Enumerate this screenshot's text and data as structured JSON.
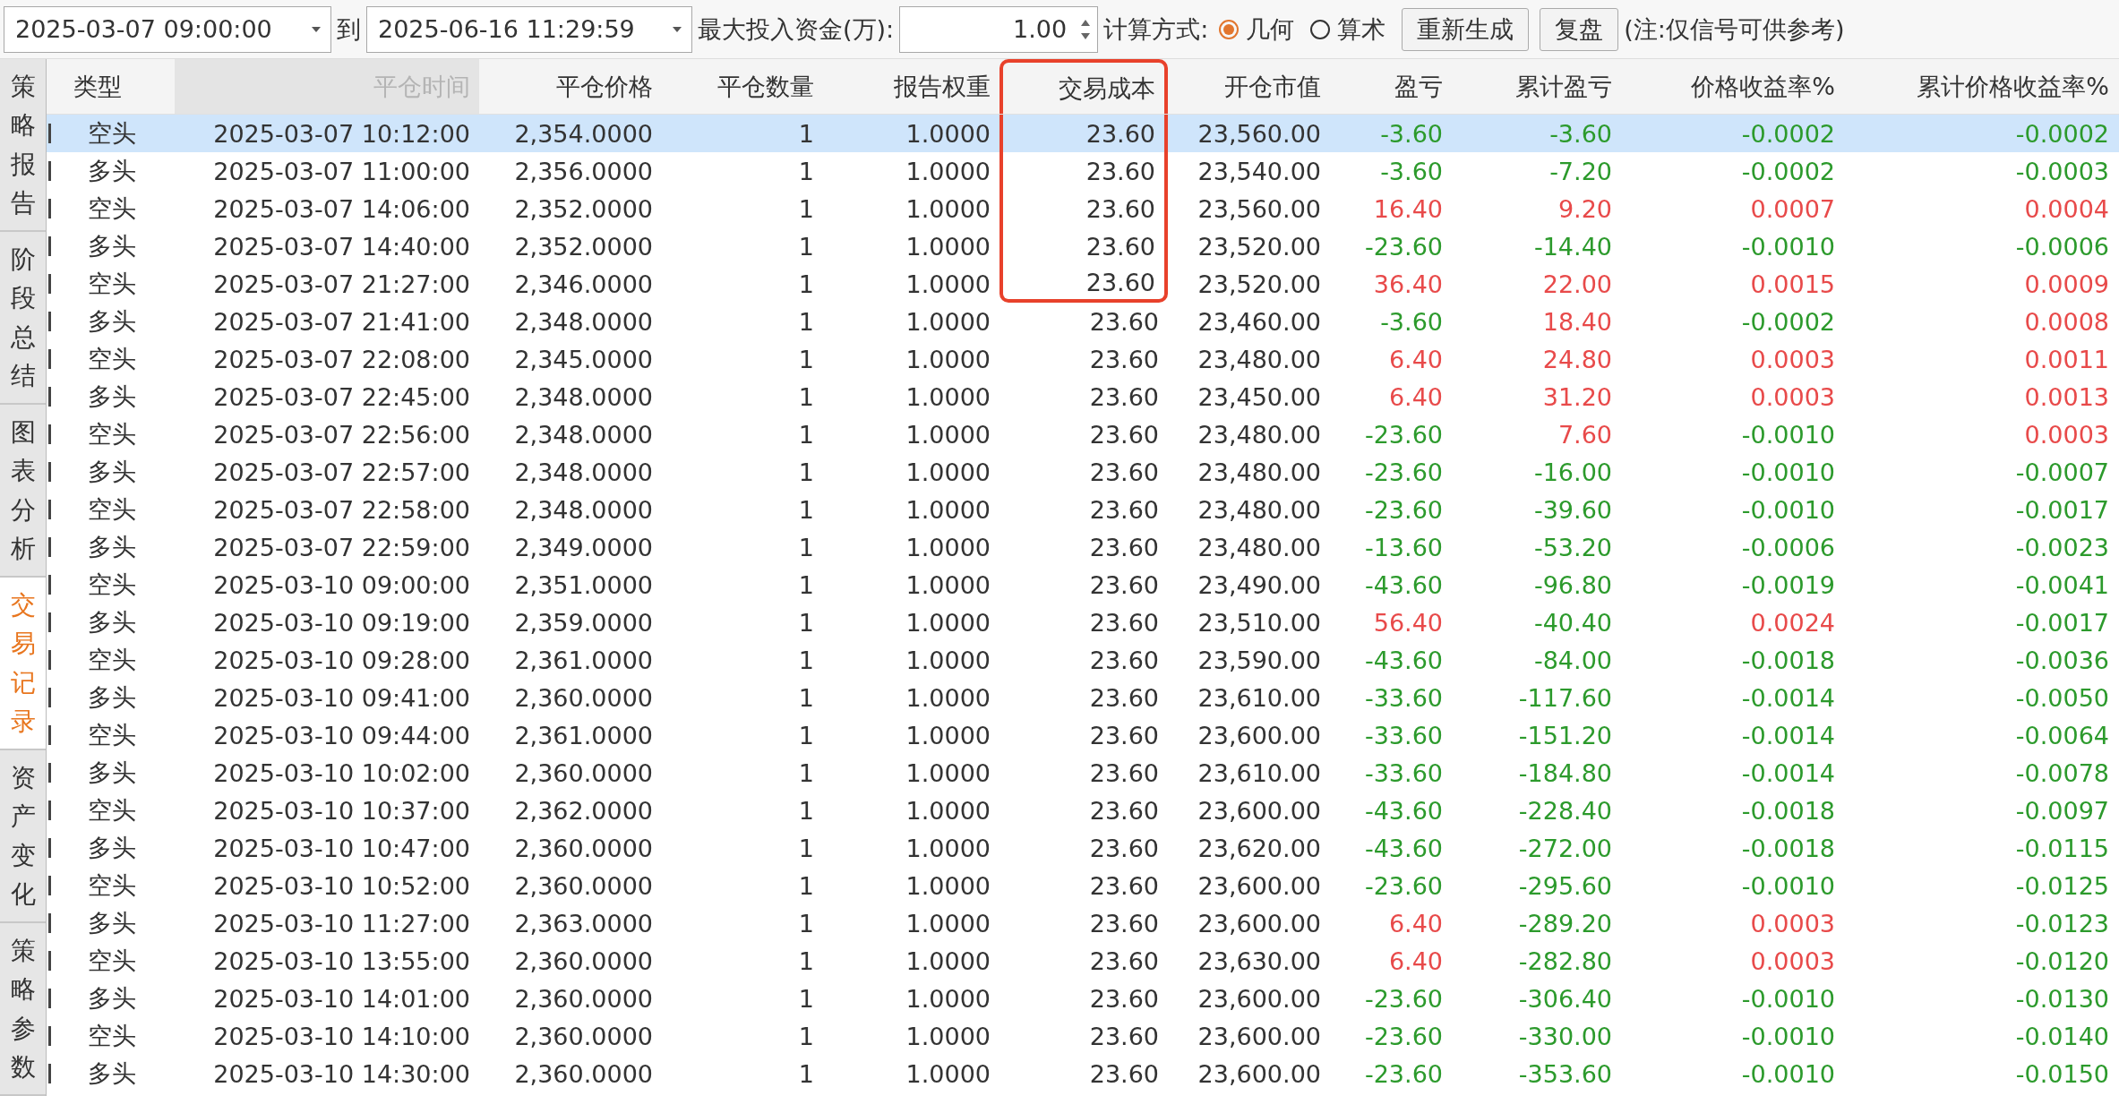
{
  "toolbar": {
    "start_date": "2025-03-07 09:00:00",
    "to_label": "到",
    "end_date": "2025-06-16 11:29:59",
    "capital_label": "最大投入资金(万):",
    "capital_value": "1.00",
    "method_label": "计算方式:",
    "methods": [
      {
        "label": "几何",
        "selected": true
      },
      {
        "label": "算术",
        "selected": false
      }
    ],
    "buttons": [
      "重新生成",
      "复盘"
    ],
    "note": "(注:仅信号可供参考)"
  },
  "side_tabs": [
    {
      "label": "策略报告",
      "selected": false
    },
    {
      "label": "阶段总结",
      "selected": false
    },
    {
      "label": "图表分析",
      "selected": false
    },
    {
      "label": "交易记录",
      "selected": true
    },
    {
      "label": "资产变化",
      "selected": false
    },
    {
      "label": "策略参数",
      "selected": false
    }
  ],
  "table": {
    "columns": [
      {
        "label": "类型",
        "dimmed": false,
        "framed": false
      },
      {
        "label": "平仓时间",
        "dimmed": true,
        "framed": false
      },
      {
        "label": "平仓价格",
        "dimmed": false,
        "framed": false
      },
      {
        "label": "平仓数量",
        "dimmed": false,
        "framed": false
      },
      {
        "label": "报告权重",
        "dimmed": false,
        "framed": false
      },
      {
        "label": "交易成本",
        "dimmed": false,
        "framed": true
      },
      {
        "label": "开仓市值",
        "dimmed": false,
        "framed": false
      },
      {
        "label": "盈亏",
        "dimmed": false,
        "framed": false
      },
      {
        "label": "累计盈亏",
        "dimmed": false,
        "framed": false
      },
      {
        "label": "价格收益率%",
        "dimmed": false,
        "framed": false
      },
      {
        "label": "累计价格收益率%",
        "dimmed": false,
        "framed": false
      }
    ],
    "rows": [
      {
        "selected": true,
        "pnl_up": false,
        "cum_up": false,
        "framed": true,
        "cells": [
          "空头",
          "2025-03-07 10:12:00",
          "2,354.0000",
          "1",
          "1.0000",
          "23.60",
          "23,560.00",
          "-3.60",
          "-3.60",
          "-0.0002",
          "-0.0002"
        ]
      },
      {
        "selected": false,
        "pnl_up": false,
        "cum_up": false,
        "framed": true,
        "cells": [
          "多头",
          "2025-03-07 11:00:00",
          "2,356.0000",
          "1",
          "1.0000",
          "23.60",
          "23,540.00",
          "-3.60",
          "-7.20",
          "-0.0002",
          "-0.0003"
        ]
      },
      {
        "selected": false,
        "pnl_up": true,
        "cum_up": true,
        "framed": true,
        "cells": [
          "空头",
          "2025-03-07 14:06:00",
          "2,352.0000",
          "1",
          "1.0000",
          "23.60",
          "23,560.00",
          "16.40",
          "9.20",
          "0.0007",
          "0.0004"
        ]
      },
      {
        "selected": false,
        "pnl_up": false,
        "cum_up": false,
        "framed": true,
        "cells": [
          "多头",
          "2025-03-07 14:40:00",
          "2,352.0000",
          "1",
          "1.0000",
          "23.60",
          "23,520.00",
          "-23.60",
          "-14.40",
          "-0.0010",
          "-0.0006"
        ]
      },
      {
        "selected": false,
        "pnl_up": true,
        "cum_up": true,
        "framed": true,
        "cells": [
          "空头",
          "2025-03-07 21:27:00",
          "2,346.0000",
          "1",
          "1.0000",
          "23.60",
          "23,520.00",
          "36.40",
          "22.00",
          "0.0015",
          "0.0009"
        ]
      },
      {
        "selected": false,
        "pnl_up": false,
        "cum_up": true,
        "framed": false,
        "cells": [
          "多头",
          "2025-03-07 21:41:00",
          "2,348.0000",
          "1",
          "1.0000",
          "23.60",
          "23,460.00",
          "-3.60",
          "18.40",
          "-0.0002",
          "0.0008"
        ]
      },
      {
        "selected": false,
        "pnl_up": true,
        "cum_up": true,
        "framed": false,
        "cells": [
          "空头",
          "2025-03-07 22:08:00",
          "2,345.0000",
          "1",
          "1.0000",
          "23.60",
          "23,480.00",
          "6.40",
          "24.80",
          "0.0003",
          "0.0011"
        ]
      },
      {
        "selected": false,
        "pnl_up": true,
        "cum_up": true,
        "framed": false,
        "cells": [
          "多头",
          "2025-03-07 22:45:00",
          "2,348.0000",
          "1",
          "1.0000",
          "23.60",
          "23,450.00",
          "6.40",
          "31.20",
          "0.0003",
          "0.0013"
        ]
      },
      {
        "selected": false,
        "pnl_up": false,
        "cum_up": true,
        "framed": false,
        "cells": [
          "空头",
          "2025-03-07 22:56:00",
          "2,348.0000",
          "1",
          "1.0000",
          "23.60",
          "23,480.00",
          "-23.60",
          "7.60",
          "-0.0010",
          "0.0003"
        ]
      },
      {
        "selected": false,
        "pnl_up": false,
        "cum_up": false,
        "framed": false,
        "cells": [
          "多头",
          "2025-03-07 22:57:00",
          "2,348.0000",
          "1",
          "1.0000",
          "23.60",
          "23,480.00",
          "-23.60",
          "-16.00",
          "-0.0010",
          "-0.0007"
        ]
      },
      {
        "selected": false,
        "pnl_up": false,
        "cum_up": false,
        "framed": false,
        "cells": [
          "空头",
          "2025-03-07 22:58:00",
          "2,348.0000",
          "1",
          "1.0000",
          "23.60",
          "23,480.00",
          "-23.60",
          "-39.60",
          "-0.0010",
          "-0.0017"
        ]
      },
      {
        "selected": false,
        "pnl_up": false,
        "cum_up": false,
        "framed": false,
        "cells": [
          "多头",
          "2025-03-07 22:59:00",
          "2,349.0000",
          "1",
          "1.0000",
          "23.60",
          "23,480.00",
          "-13.60",
          "-53.20",
          "-0.0006",
          "-0.0023"
        ]
      },
      {
        "selected": false,
        "pnl_up": false,
        "cum_up": false,
        "framed": false,
        "cells": [
          "空头",
          "2025-03-10 09:00:00",
          "2,351.0000",
          "1",
          "1.0000",
          "23.60",
          "23,490.00",
          "-43.60",
          "-96.80",
          "-0.0019",
          "-0.0041"
        ]
      },
      {
        "selected": false,
        "pnl_up": true,
        "cum_up": false,
        "framed": false,
        "cells": [
          "多头",
          "2025-03-10 09:19:00",
          "2,359.0000",
          "1",
          "1.0000",
          "23.60",
          "23,510.00",
          "56.40",
          "-40.40",
          "0.0024",
          "-0.0017"
        ]
      },
      {
        "selected": false,
        "pnl_up": false,
        "cum_up": false,
        "framed": false,
        "cells": [
          "空头",
          "2025-03-10 09:28:00",
          "2,361.0000",
          "1",
          "1.0000",
          "23.60",
          "23,590.00",
          "-43.60",
          "-84.00",
          "-0.0018",
          "-0.0036"
        ]
      },
      {
        "selected": false,
        "pnl_up": false,
        "cum_up": false,
        "framed": false,
        "cells": [
          "多头",
          "2025-03-10 09:41:00",
          "2,360.0000",
          "1",
          "1.0000",
          "23.60",
          "23,610.00",
          "-33.60",
          "-117.60",
          "-0.0014",
          "-0.0050"
        ]
      },
      {
        "selected": false,
        "pnl_up": false,
        "cum_up": false,
        "framed": false,
        "cells": [
          "空头",
          "2025-03-10 09:44:00",
          "2,361.0000",
          "1",
          "1.0000",
          "23.60",
          "23,600.00",
          "-33.60",
          "-151.20",
          "-0.0014",
          "-0.0064"
        ]
      },
      {
        "selected": false,
        "pnl_up": false,
        "cum_up": false,
        "framed": false,
        "cells": [
          "多头",
          "2025-03-10 10:02:00",
          "2,360.0000",
          "1",
          "1.0000",
          "23.60",
          "23,610.00",
          "-33.60",
          "-184.80",
          "-0.0014",
          "-0.0078"
        ]
      },
      {
        "selected": false,
        "pnl_up": false,
        "cum_up": false,
        "framed": false,
        "cells": [
          "空头",
          "2025-03-10 10:37:00",
          "2,362.0000",
          "1",
          "1.0000",
          "23.60",
          "23,600.00",
          "-43.60",
          "-228.40",
          "-0.0018",
          "-0.0097"
        ]
      },
      {
        "selected": false,
        "pnl_up": false,
        "cum_up": false,
        "framed": false,
        "cells": [
          "多头",
          "2025-03-10 10:47:00",
          "2,360.0000",
          "1",
          "1.0000",
          "23.60",
          "23,620.00",
          "-43.60",
          "-272.00",
          "-0.0018",
          "-0.0115"
        ]
      },
      {
        "selected": false,
        "pnl_up": false,
        "cum_up": false,
        "framed": false,
        "cells": [
          "空头",
          "2025-03-10 10:52:00",
          "2,360.0000",
          "1",
          "1.0000",
          "23.60",
          "23,600.00",
          "-23.60",
          "-295.60",
          "-0.0010",
          "-0.0125"
        ]
      },
      {
        "selected": false,
        "pnl_up": true,
        "cum_up": false,
        "framed": false,
        "cells": [
          "多头",
          "2025-03-10 11:27:00",
          "2,363.0000",
          "1",
          "1.0000",
          "23.60",
          "23,600.00",
          "6.40",
          "-289.20",
          "0.0003",
          "-0.0123"
        ]
      },
      {
        "selected": false,
        "pnl_up": true,
        "cum_up": false,
        "framed": false,
        "cells": [
          "空头",
          "2025-03-10 13:55:00",
          "2,360.0000",
          "1",
          "1.0000",
          "23.60",
          "23,630.00",
          "6.40",
          "-282.80",
          "0.0003",
          "-0.0120"
        ]
      },
      {
        "selected": false,
        "pnl_up": false,
        "cum_up": false,
        "framed": false,
        "cells": [
          "多头",
          "2025-03-10 14:01:00",
          "2,360.0000",
          "1",
          "1.0000",
          "23.60",
          "23,600.00",
          "-23.60",
          "-306.40",
          "-0.0010",
          "-0.0130"
        ]
      },
      {
        "selected": false,
        "pnl_up": false,
        "cum_up": false,
        "framed": false,
        "cells": [
          "空头",
          "2025-03-10 14:10:00",
          "2,360.0000",
          "1",
          "1.0000",
          "23.60",
          "23,600.00",
          "-23.60",
          "-330.00",
          "-0.0010",
          "-0.0140"
        ]
      },
      {
        "selected": false,
        "pnl_up": false,
        "cum_up": false,
        "framed": false,
        "cells": [
          "多头",
          "2025-03-10 14:30:00",
          "2,360.0000",
          "1",
          "1.0000",
          "23.60",
          "23,600.00",
          "-23.60",
          "-353.60",
          "-0.0010",
          "-0.0150"
        ]
      }
    ]
  }
}
